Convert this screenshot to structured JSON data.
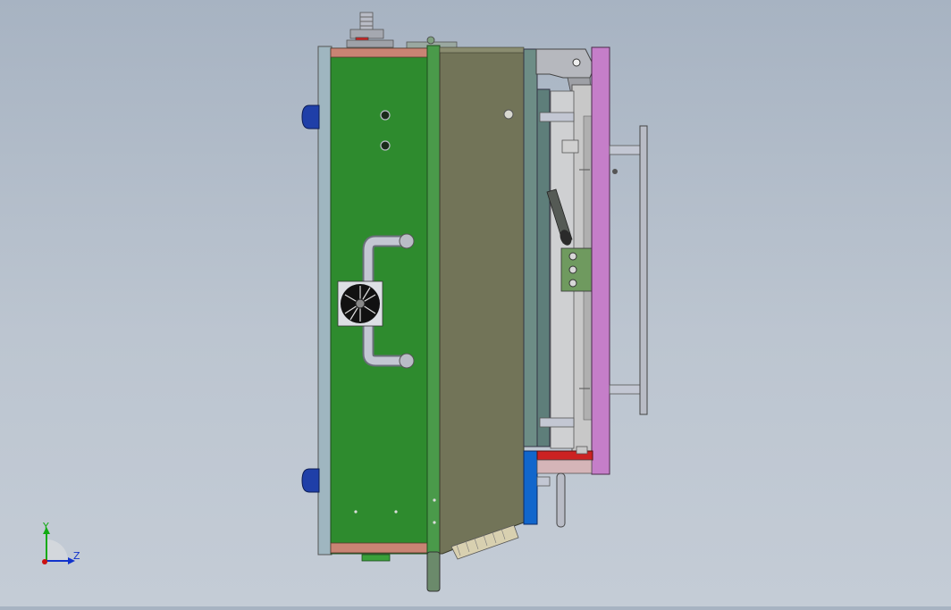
{
  "viewport": {
    "background_top": "#a7b3c2",
    "background_bottom": "#c4ccd6"
  },
  "colors": {
    "green_plate": "#2e8b2e",
    "olive_plate": "#727458",
    "magenta_plate": "#c57ec9",
    "light_gray_plate": "#c8c8c8",
    "blue_part": "#1166cc",
    "red_part": "#cc2222",
    "salmon_strip": "#c98474",
    "steel": "#b9bcc6"
  },
  "triad": {
    "x_axis_color": "#cc1111",
    "y_axis_color": "#11aa11",
    "z_axis_color": "#1133cc",
    "y_label": "Y",
    "z_label": "Z"
  }
}
